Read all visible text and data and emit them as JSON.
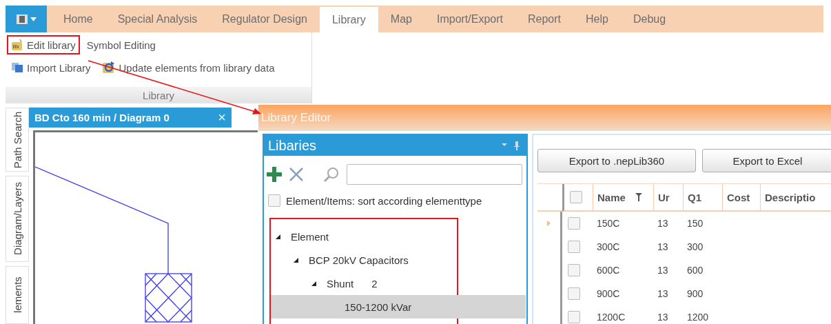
{
  "ribbon": {
    "tabs": [
      {
        "label": "Home",
        "selected": false
      },
      {
        "label": "Special Analysis",
        "selected": false
      },
      {
        "label": "Regulator Design",
        "selected": false
      },
      {
        "label": "Library",
        "selected": true
      },
      {
        "label": "Map",
        "selected": false
      },
      {
        "label": "Import/Export",
        "selected": false
      },
      {
        "label": "Report",
        "selected": false
      },
      {
        "label": "Help",
        "selected": false
      },
      {
        "label": "Debug",
        "selected": false
      }
    ],
    "group": {
      "label": "Library",
      "rows": [
        [
          {
            "label": "Edit library",
            "kind": "edit",
            "highlighted": true
          },
          {
            "label": "Symbol Editing",
            "kind": "text",
            "highlighted": false
          }
        ],
        [
          {
            "label": "Import Library",
            "kind": "import",
            "highlighted": false
          },
          {
            "label": "Update elements from library data",
            "kind": "update",
            "highlighted": false
          }
        ]
      ]
    }
  },
  "side_tabs": [
    {
      "label": "Path Search"
    },
    {
      "label": "Diagram/Layers"
    },
    {
      "label": "lements"
    }
  ],
  "document": {
    "title": "BD Cto 160 min / Diagram 0",
    "close": "×"
  },
  "library_editor": {
    "title": "Library Editor",
    "libraries_panel": {
      "title": "Libaries",
      "sort_checkbox": {
        "label": "Element/Items: sort according elementtype",
        "checked": false
      },
      "tree": {
        "highlighted": true,
        "items": [
          {
            "label": "Element",
            "expanded": true,
            "selected": false,
            "children": [
              {
                "label": "BCP 20kV Capacitors",
                "expanded": true,
                "selected": false,
                "children": [
                  {
                    "label": "Shunt",
                    "count": "2",
                    "expanded": true,
                    "selected": false,
                    "children": [
                      {
                        "label": "150-1200 kVar",
                        "selected": true
                      }
                    ]
                  }
                ]
              }
            ]
          }
        ]
      }
    },
    "buttons": [
      "Export to .nepLib360",
      "Export to Excel"
    ],
    "table": {
      "select_all_checked": false,
      "columns": [
        "Name",
        "Ur",
        "Q1",
        "Cost",
        "Descriptio"
      ],
      "rows": [
        {
          "current": true,
          "checked": false,
          "cells": [
            "150C",
            "13",
            "150"
          ]
        },
        {
          "current": false,
          "checked": false,
          "cells": [
            "300C",
            "13",
            "300"
          ]
        },
        {
          "current": false,
          "checked": false,
          "cells": [
            "600C",
            "13",
            "600"
          ]
        },
        {
          "current": false,
          "checked": false,
          "cells": [
            "900C",
            "13",
            "900"
          ]
        },
        {
          "current": false,
          "checked": false,
          "cells": [
            "1200C",
            "13",
            "1200"
          ]
        }
      ]
    }
  }
}
